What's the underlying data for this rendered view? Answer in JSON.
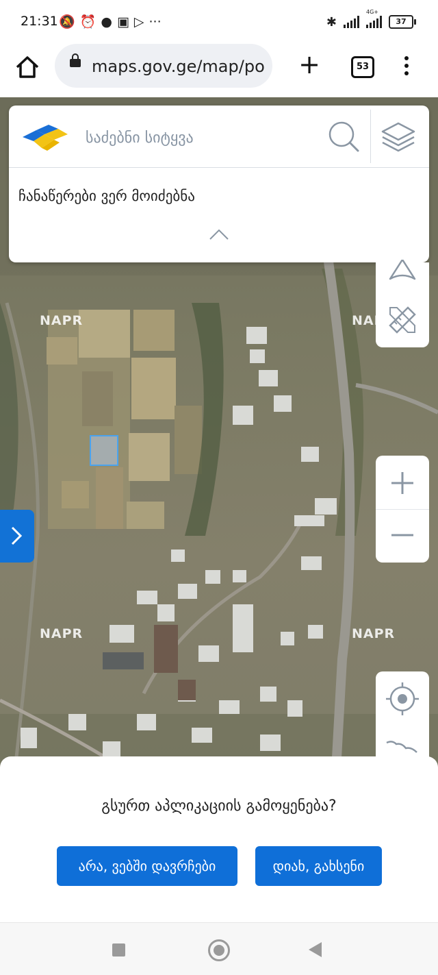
{
  "status_bar": {
    "time": "21:31",
    "icons": [
      "mute-icon",
      "alarm-icon",
      "circle-icon",
      "cast-icon",
      "send-icon",
      "more-icon"
    ],
    "network": "4G+",
    "battery": "37"
  },
  "browser": {
    "url": "maps.gov.ge/map/po",
    "tab_count": "53"
  },
  "search": {
    "placeholder": "საძებნი სიტყვა",
    "no_results": "ჩანაწერები ვერ მოიძებნა"
  },
  "map": {
    "watermark": "NAPR"
  },
  "prompt": {
    "question": "გსურთ აპლიკაციის გამოყენება?",
    "stay_web_label": "არა, ვებში დავრჩები",
    "open_app_label": "დიახ, გახსენი"
  },
  "colors": {
    "accent": "#0f6fd8",
    "icon_gray": "#8a96a3"
  }
}
